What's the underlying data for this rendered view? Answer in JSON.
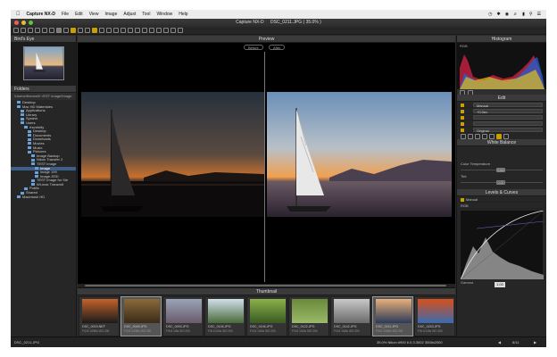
{
  "menubar": {
    "apple": "",
    "app_name": "Capture NX-D",
    "items": [
      "File",
      "Edit",
      "View",
      "Image",
      "Adjust",
      "Tool",
      "Window",
      "Help"
    ]
  },
  "window": {
    "title": "Capture NX-D",
    "filename": "DSC_0211.JPG ( 35.0% )"
  },
  "left_panel": {
    "birdseye_title": "Bird's Eye",
    "folders_title": "Folders",
    "path": "/Users/rtherwell/~/EST Image/Image",
    "tree": [
      {
        "label": "Desktop",
        "level": 1
      },
      {
        "label": "Mac HD Materiales",
        "level": 1
      },
      {
        "label": "Applications",
        "level": 2
      },
      {
        "label": "Library",
        "level": 2
      },
      {
        "label": "System",
        "level": 2
      },
      {
        "label": "Users",
        "level": 2
      },
      {
        "label": "rhcretelly",
        "level": 3
      },
      {
        "label": "Desktop",
        "level": 4
      },
      {
        "label": "Documents",
        "level": 4
      },
      {
        "label": "Downloads",
        "level": 4
      },
      {
        "label": "Movies",
        "level": 4
      },
      {
        "label": "Music",
        "level": 4
      },
      {
        "label": "Pictures",
        "level": 4
      },
      {
        "label": "Image Backup",
        "level": 5
      },
      {
        "label": "Nikon Transfer 2",
        "level": 5
      },
      {
        "label": "TEST Image",
        "level": 5
      },
      {
        "label": "Image",
        "level": 6,
        "selected": true
      },
      {
        "label": "image 199",
        "level": 6
      },
      {
        "label": "Image-SSD",
        "level": 6
      },
      {
        "label": "TEST Image for Sie",
        "level": 5
      },
      {
        "label": "Wi-max Transmit",
        "level": 5
      },
      {
        "label": "Public",
        "level": 3
      },
      {
        "label": "Shared",
        "level": 2
      },
      {
        "label": "Macintosh HD",
        "level": 1
      }
    ]
  },
  "center": {
    "preview_title": "Preview",
    "before_label": "Before",
    "after_label": "After",
    "thumbnail_title": "Thumbnail",
    "thumbnails": [
      {
        "name": "DSC_0015.NEF",
        "info": "F/2.8 1/250s ISO 200",
        "colors": [
          "#c4622b",
          "#1b1b1b"
        ],
        "selected": false
      },
      {
        "name": "DSC_0049.JPG",
        "info": "F/2.8 1/250s ISO 200",
        "colors": [
          "#8a6a3a",
          "#3a2a18"
        ],
        "selected": true
      },
      {
        "name": "DSC_0093.JPG",
        "info": "F/5.6 1/8s ISO 200",
        "colors": [
          "#9aa4b8",
          "#6a5a6a"
        ],
        "selected": false
      },
      {
        "name": "DSC_0104.JPG",
        "info": "F/8 1/100s ISO 200",
        "colors": [
          "#d0e0ea",
          "#4a6a3a"
        ],
        "selected": false
      },
      {
        "name": "DSC_0106.JPG",
        "info": "F/4.5 1/40s ISO 200",
        "colors": [
          "#8ab04a",
          "#3a5a22"
        ],
        "selected": false
      },
      {
        "name": "DSC_0122.JPG",
        "info": "F/4.5 1/40s ISO 200",
        "colors": [
          "#6a8a3a",
          "#9aba6a"
        ],
        "selected": false
      },
      {
        "name": "DSC_0142.JPG",
        "info": "F/3.5 1/45s ISO 200",
        "colors": [
          "#c8c8c8",
          "#6a6a6a"
        ],
        "selected": false
      },
      {
        "name": "DSC_0211.JPG",
        "info": "F/5.6 1/250s ISO 200",
        "colors": [
          "#e8b07a",
          "#2a3a5a"
        ],
        "selected": true
      },
      {
        "name": "DSC_0243.JPG",
        "info": "F/8 1/125s ISO 200",
        "colors": [
          "#d8501a",
          "#3a6ab0"
        ],
        "selected": false
      }
    ]
  },
  "right_panel": {
    "histogram_title": "Histogram",
    "histogram_mode": "RGB",
    "edit_title": "Edit",
    "edit_rows": [
      "Manual",
      "+0.0ev",
      "",
      "",
      "Original"
    ],
    "wb_title": "White Balance",
    "wb_rows": [
      {
        "label": "Color Temperature",
        "value": "5350"
      },
      {
        "label": "Tint",
        "value": "0.00"
      }
    ],
    "levels_title": "Levels & Curves",
    "levels_mode": "Manual",
    "curve_channel": "RGB",
    "gamma_label": "Gamma",
    "gamma_value": "1.00"
  },
  "statusbar": {
    "left": "DSC_0211.JPG",
    "center": "35.0%  Nikon #900 6.0.3.3002  3008x2000",
    "page": "8/11"
  }
}
